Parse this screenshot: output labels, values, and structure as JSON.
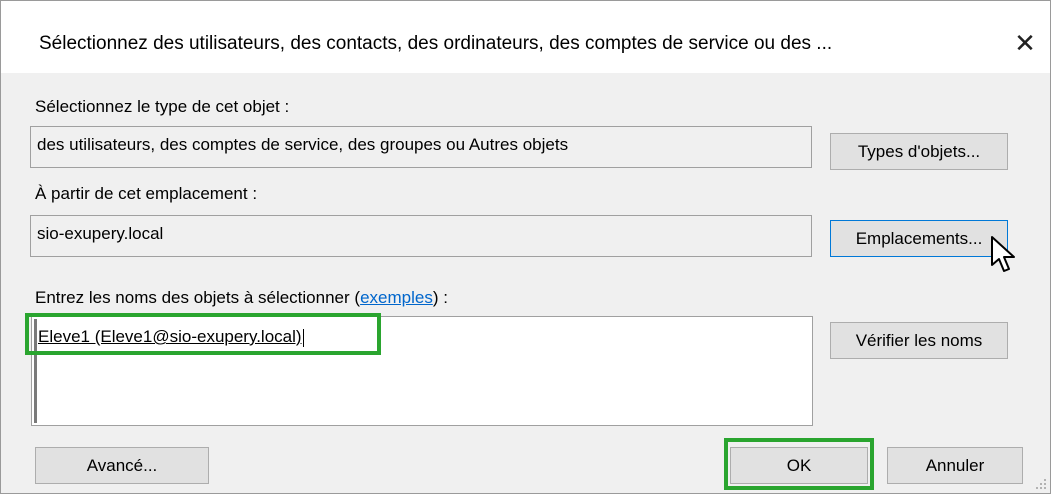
{
  "window": {
    "title": "Sélectionnez des utilisateurs, des contacts, des ordinateurs, des comptes de service ou des ...",
    "close_symbol": "✕"
  },
  "object_type": {
    "label": "Sélectionnez le type de cet objet :",
    "value": "des utilisateurs, des comptes de service, des groupes ou Autres objets",
    "button_label": "Types d'objets..."
  },
  "location": {
    "label": "À partir de cet emplacement :",
    "value": "sio-exupery.local",
    "button_label": "Emplacements..."
  },
  "names": {
    "label_prefix": "Entrez les noms des objets à sélectionner (",
    "label_link": "exemples",
    "label_suffix": ") :",
    "value": "Eleve1 (Eleve1@sio-exupery.local)",
    "check_button_label": "Vérifier les noms"
  },
  "footer": {
    "advanced_label": "Avancé...",
    "ok_label": "OK",
    "cancel_label": "Annuler"
  },
  "colors": {
    "highlight": "#2aa52f",
    "link": "#0066cc",
    "focus_border": "#0078d7"
  },
  "icons": {
    "close": "close-icon",
    "cursor": "mouse-pointer-icon",
    "grip": "resize-grip-icon"
  }
}
